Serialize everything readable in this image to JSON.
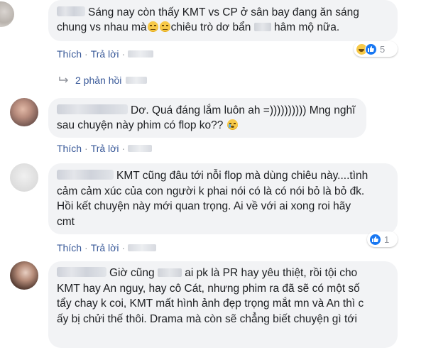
{
  "comments": [
    {
      "text_parts": [
        "Sáng nay còn thấy KMT vs CP ở sân bay đang ăn sáng",
        "chung vs nhau mà",
        "chiêu trò dơ bẩn",
        "hâm mộ nữa."
      ],
      "reaction_count": "5",
      "reply_count_label": "2 phản hồi"
    },
    {
      "text_parts": [
        "Dơ. Quá đáng lắm luôn ah =)))))))))) Mng nghĩ",
        "sau chuyện này phim có flop ko??"
      ]
    },
    {
      "text_lines": [
        "KMT cũng đâu tới nỗi flop mà dùng chiêu này....tình",
        "cảm cảm xúc của con người k phai nói có là có nói bỏ là bỏ đk.",
        "Hồi kết chuyện này mới quan trọng. Ai về với ai xong roi hãy",
        "cmt"
      ],
      "reaction_count": "1"
    },
    {
      "text_parts": [
        "Giờ cũng",
        "ai pk là PR hay yêu thiệt, rồi tội cho",
        "KMT hay An nguy, hay cô Cát, nhưng phim ra đã sẽ có một số",
        "tẩy chay k coi, KMT mất hình ảnh đẹp trọng mắt mn và An thì c",
        "ấy bị chửi thế thôi. Drama mà còn sẽ chẳng biết chuyện gì tới"
      ]
    }
  ],
  "actions": {
    "like": "Thích",
    "reply": "Trả lời",
    "separator": "·"
  },
  "colors": {
    "link": "#385898",
    "bubble": "#f2f3f5",
    "like_blue": "#1877f2"
  }
}
